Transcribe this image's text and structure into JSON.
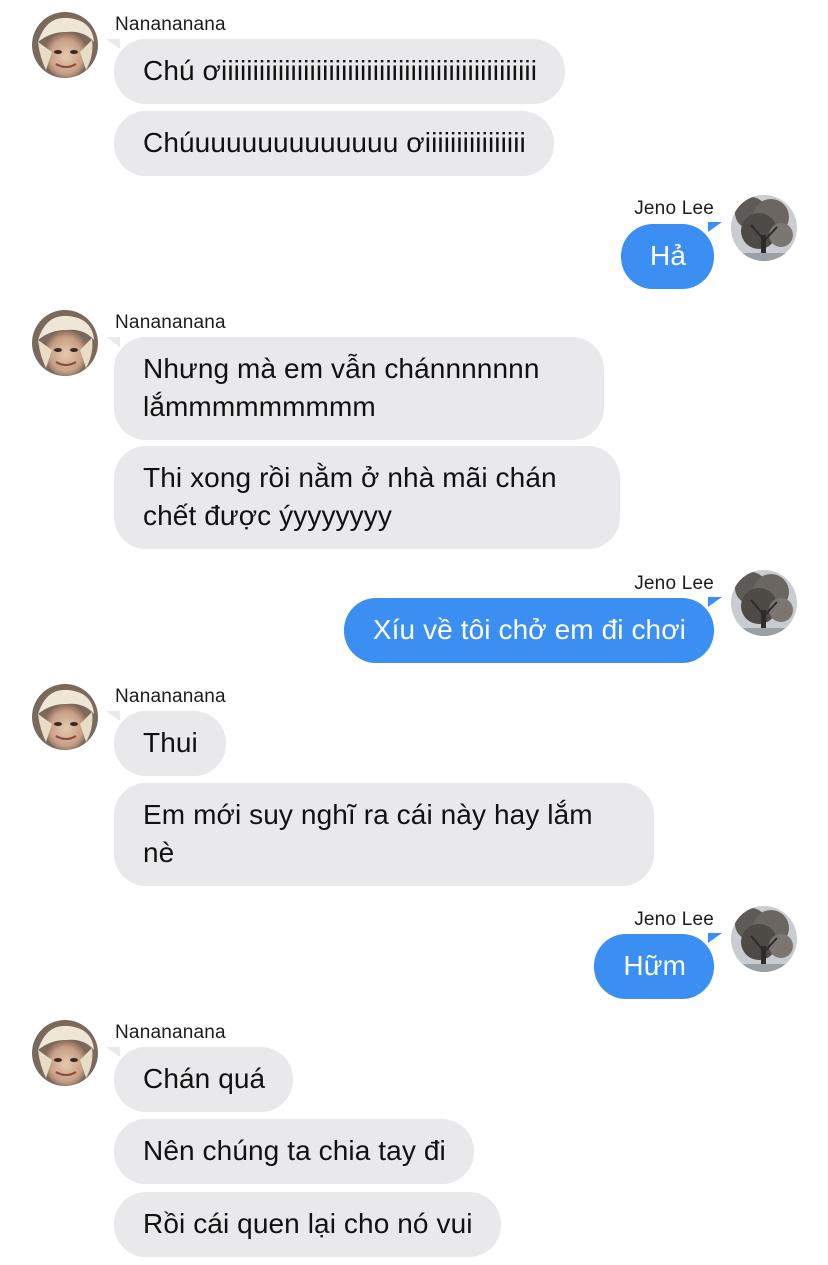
{
  "colors": {
    "incoming_bubble": "#e9e9eb",
    "outgoing_bubble": "#3b8ef2",
    "incoming_text": "#111111",
    "outgoing_text": "#ffffff"
  },
  "icons": {
    "nana_avatar": "avatar-photo-icon",
    "jeno_avatar": "avatar-tree-icon"
  },
  "groups": [
    {
      "sender": "Nanananana",
      "messages": [
        "Chú ơiiiiiiiiiiiiiiiiiiiiiiiiiiiiiiiiiiiiiiiiiiiiiiiiii",
        "Chúuuuuuuuuuuuuu ơiiiiiiiiiiiiiiii"
      ]
    },
    {
      "sender": "Jeno Lee",
      "messages": [
        "Hả"
      ]
    },
    {
      "sender": "Nanananana",
      "messages": [
        "Nhưng mà em vẫn chánnnnnnn lắmmmmmmmmm",
        "Thi xong rồi nằm ở nhà mãi chán chết được ýyyyyyyy"
      ]
    },
    {
      "sender": "Jeno Lee",
      "messages": [
        "Xíu về tôi chở em đi chơi"
      ]
    },
    {
      "sender": "Nanananana",
      "messages": [
        "Thui",
        "Em mới suy nghĩ ra cái này hay lắm nè"
      ]
    },
    {
      "sender": "Jeno Lee",
      "messages": [
        "Hữm"
      ]
    },
    {
      "sender": "Nanananana",
      "messages": [
        "Chán quá",
        "Nên chúng ta chia tay đi",
        "Rồi cái quen lại cho nó vui"
      ]
    }
  ]
}
